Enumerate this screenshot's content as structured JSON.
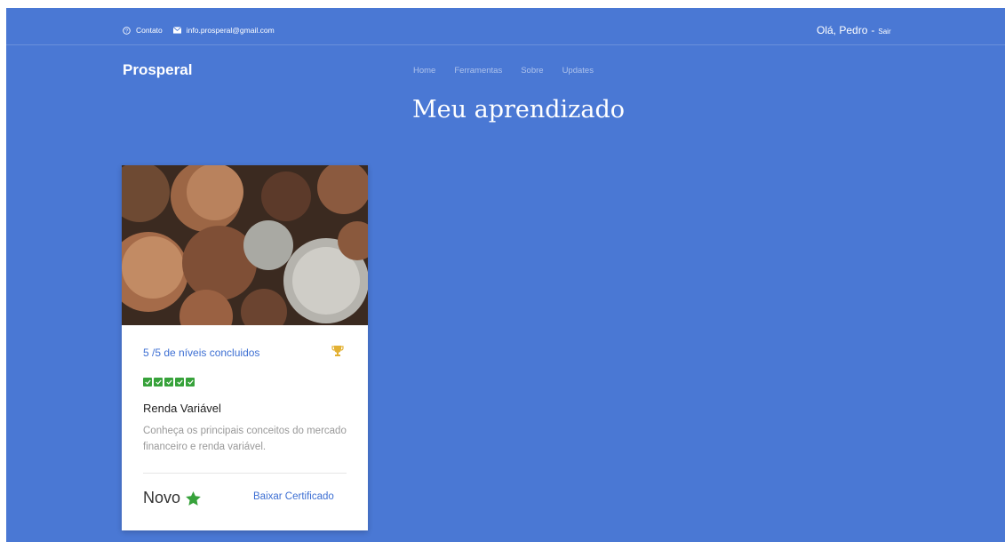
{
  "topbar": {
    "contact_label": "Contato",
    "email": "info.prosperal@gmail.com",
    "greeting": "Olá, Pedro",
    "separator": "-",
    "logout": "Sair"
  },
  "brand": "Prosperal",
  "nav": [
    "Home",
    "Ferramentas",
    "Sobre",
    "Updates"
  ],
  "page_title": "Meu aprendizado",
  "course": {
    "progress_text": "5 /5 de níveis concluidos",
    "levels_completed": 5,
    "levels_total": 5,
    "title": "Renda Variável",
    "description": "Conheça os principais conceitos do mercado financeiro e renda variável.",
    "status": "Novo",
    "certificate_link": "Baixar Certificado",
    "image_icon": "coins-photo",
    "trophy_icon": "trophy-icon",
    "star_icon": "star-icon"
  },
  "colors": {
    "background": "#4a78d4",
    "link": "#3d6fd3",
    "success": "#37a23b",
    "trophy": "#e3b133"
  }
}
